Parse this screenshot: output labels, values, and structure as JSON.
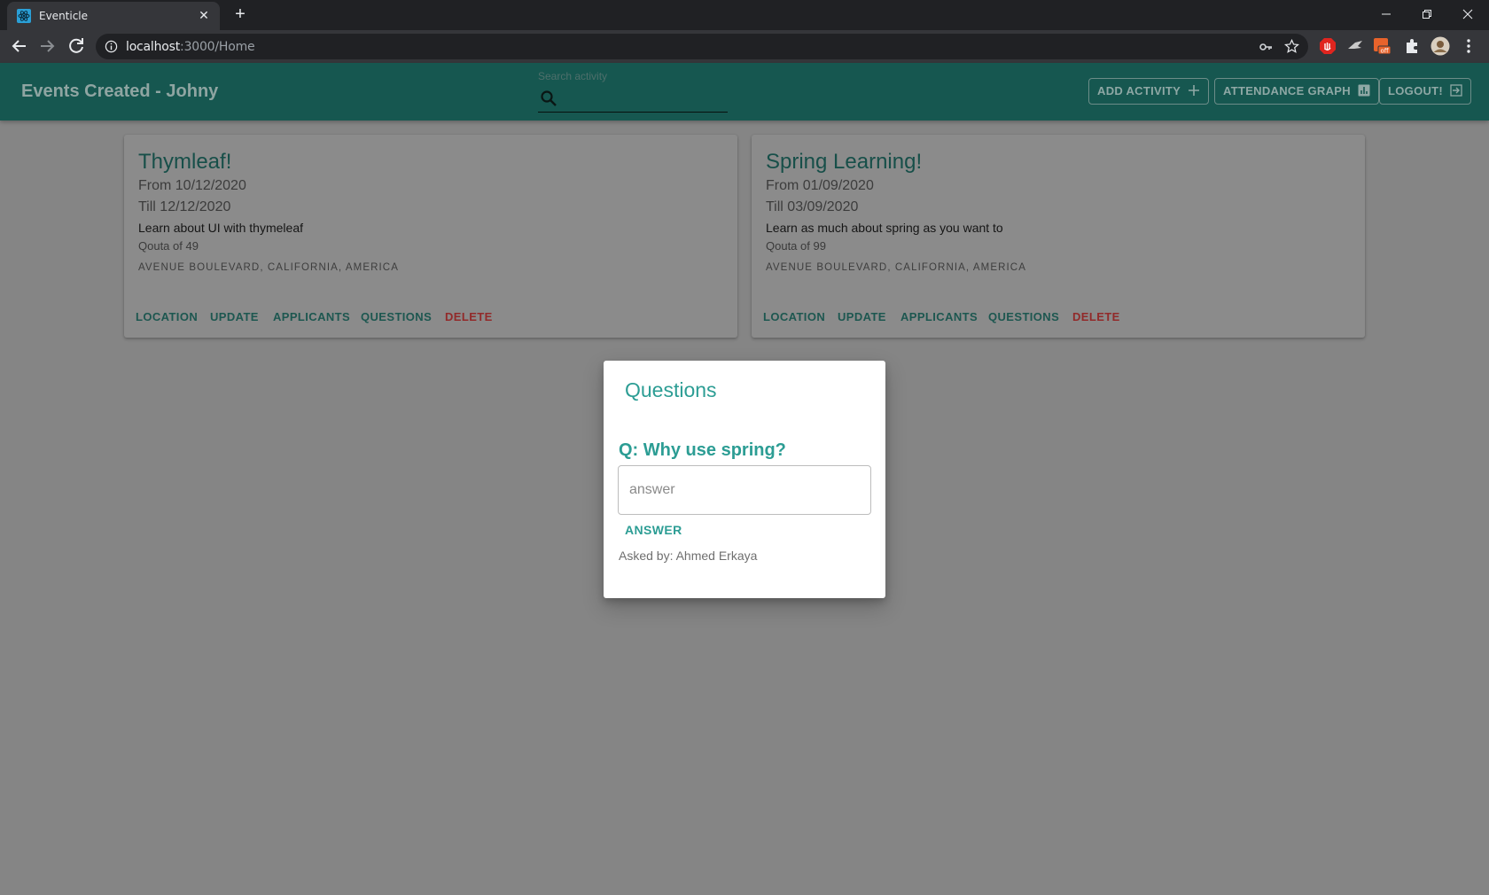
{
  "browser": {
    "tab_title": "Eventicle",
    "url_host": "localhost",
    "url_path": ":3000/Home"
  },
  "app": {
    "title": "Events Created - Johny",
    "search": {
      "label": "Search activity",
      "placeholder": ""
    },
    "buttons": {
      "add_activity": "ADD ACTIVITY",
      "attendance_graph": "ATTENDANCE GRAPH",
      "logout": "LOGOUT!"
    }
  },
  "events": [
    {
      "title": "Thymleaf!",
      "from": "From 10/12/2020",
      "till": "Till 12/12/2020",
      "description": "Learn about UI with thymeleaf",
      "quota": "Qouta of 49",
      "location": "AVENUE BOULEVARD, CALIFORNIA, AMERICA",
      "actions": {
        "location": "LOCATION",
        "update": "UPDATE",
        "applicants": "APPLICANTS",
        "questions": "QUESTIONS",
        "delete": "DELETE"
      }
    },
    {
      "title": "Spring Learning!",
      "from": "From 01/09/2020",
      "till": "Till 03/09/2020",
      "description": "Learn as much about spring as you want to",
      "quota": "Qouta of 99",
      "location": "AVENUE BOULEVARD, CALIFORNIA, AMERICA",
      "actions": {
        "location": "LOCATION",
        "update": "UPDATE",
        "applicants": "APPLICANTS",
        "questions": "QUESTIONS",
        "delete": "DELETE"
      }
    }
  ],
  "dialog": {
    "title": "Questions",
    "question": "Q: Why use spring?",
    "answer_placeholder": "answer",
    "answer_button": "ANSWER",
    "asked_by": "Asked by: Ahmed Erkaya"
  },
  "colors": {
    "app_bar": "#165750",
    "accent": "#2c9d94",
    "danger": "#922a2a",
    "overlay": "#858585"
  }
}
